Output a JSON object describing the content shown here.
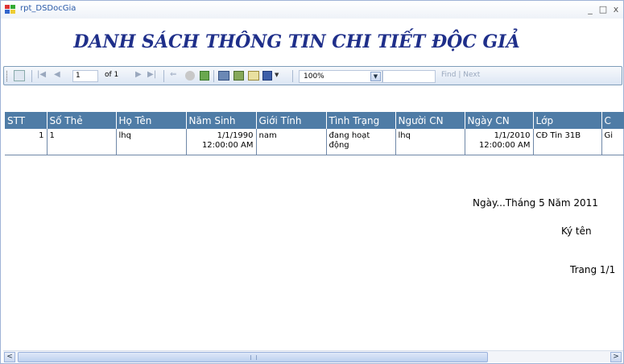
{
  "window": {
    "title": "rpt_DSDocGia",
    "minimize_label": "_",
    "maximize_label": "□",
    "close_label": "x"
  },
  "toolbar": {
    "first_label": "|◀",
    "prev_label": "◀",
    "page_value": "1",
    "of_text": "of 1",
    "next_label": "▶",
    "last_label": "▶|",
    "back_label": "⇐",
    "zoom_value": "100%",
    "zoom_arrow": "▼",
    "save_arrow": "▼",
    "find_label": "Find",
    "find_sep": "|",
    "next_find_label": "Next"
  },
  "report": {
    "title": "DANH SÁCH THÔNG TIN CHI TIẾT ĐỘC GIẢ",
    "columns": [
      "STT",
      "Số Thẻ",
      "Họ Tên",
      "Năm Sinh",
      "Giới Tính",
      "Tình Trạng",
      "Người CN",
      "Ngày CN",
      "Lớp",
      "C"
    ],
    "rows": [
      {
        "stt": "1",
        "so_the": "1",
        "ho_ten": "lhq",
        "nam_sinh_1": "1/1/1990",
        "nam_sinh_2": "12:00:00 AM",
        "gioi_tinh": "nam",
        "tinh_trang_1": "đang hoạt",
        "tinh_trang_2": "động",
        "nguoi_cn": "lhq",
        "ngay_cn_1": "1/1/2010",
        "ngay_cn_2": "12:00:00 AM",
        "lop": "CĐ Tin 31B",
        "c": "Gi"
      }
    ],
    "date_text": "Ngày...Tháng 5 Năm 2011",
    "sign_text": "Ký tên",
    "page_text": "Trang 1/1"
  },
  "scrollbar": {
    "left_label": "<",
    "right_label": ">"
  }
}
